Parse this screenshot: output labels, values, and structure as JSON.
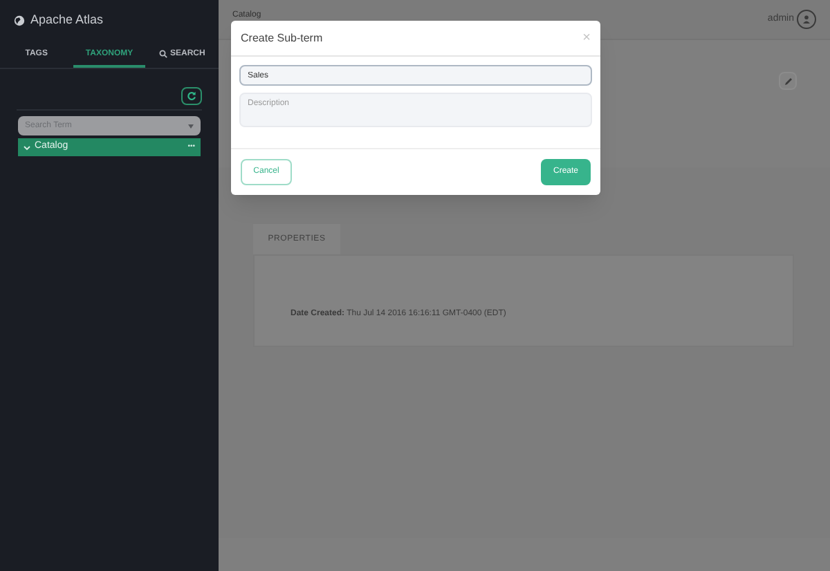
{
  "app": {
    "title": "Apache Atlas"
  },
  "tabs": [
    {
      "label": "TAGS",
      "selected": false,
      "kind": "plain"
    },
    {
      "label": "TAXONOMY",
      "selected": true,
      "kind": "plain"
    },
    {
      "label": "SEARCH",
      "selected": false,
      "kind": "search"
    }
  ],
  "search": {
    "placeholder": "Search Term"
  },
  "tree": [
    {
      "label": "Catalog",
      "expanded": true,
      "selected": true,
      "menu": "•••"
    }
  ],
  "header": {
    "breadcrumb": "Catalog",
    "user": "admin"
  },
  "properties": {
    "tab": "PROPERTIES",
    "label": "Date Created:",
    "value": "Thu Jul 14 2016 16:16:11 GMT-0400 (EDT)"
  },
  "modal": {
    "title": "Create Sub-term",
    "close": "×",
    "name_value": "Sales",
    "description_placeholder": "Description",
    "cancel": "Cancel",
    "create": "Create"
  }
}
